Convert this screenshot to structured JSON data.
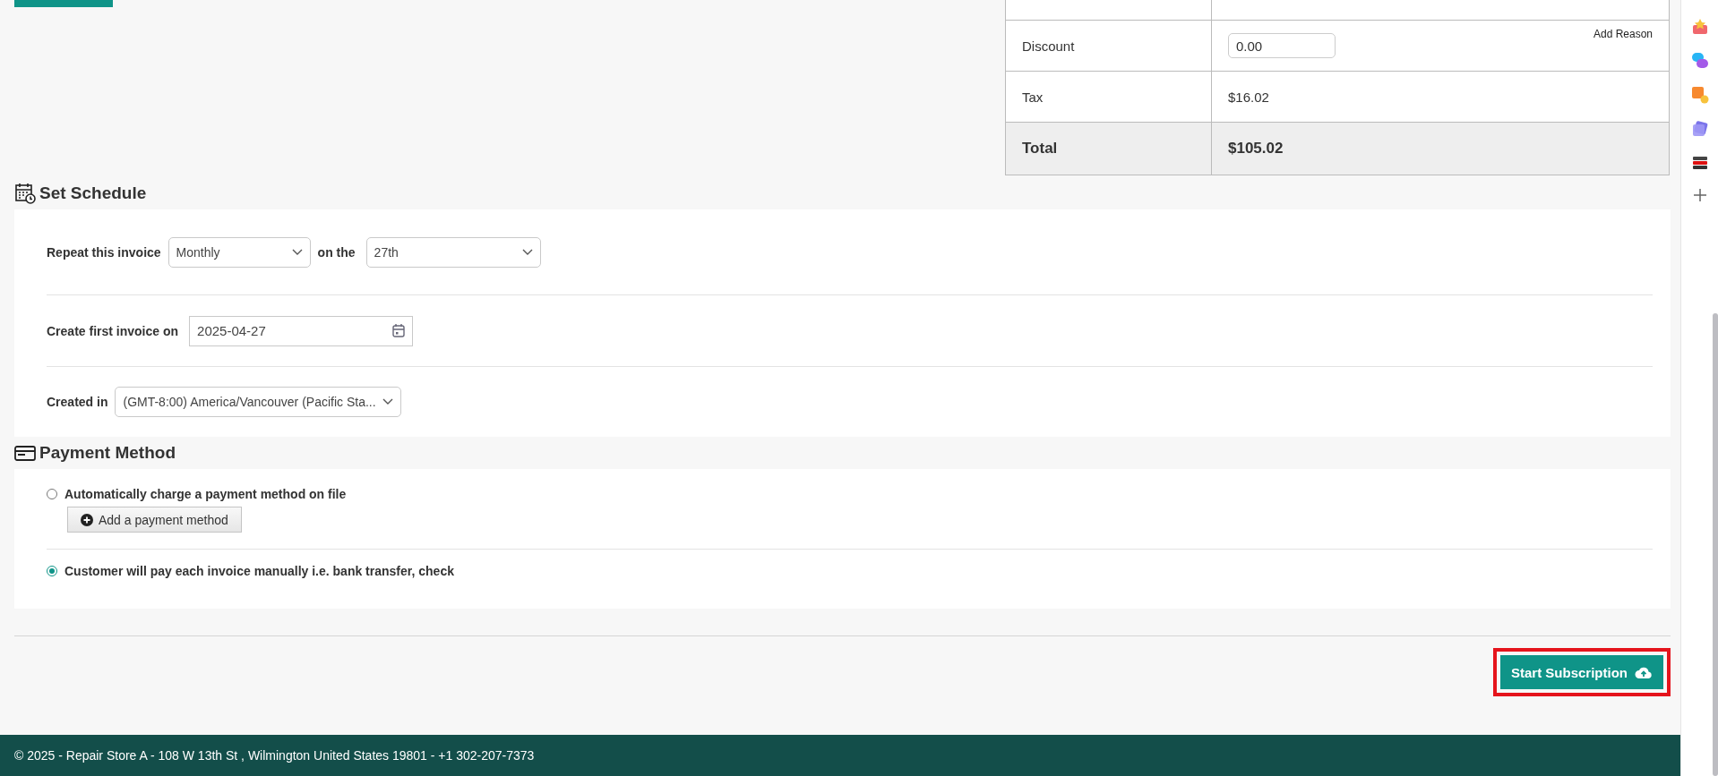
{
  "summary_table": {
    "rows": [
      {
        "kind": "blank",
        "label": "",
        "value": ""
      },
      {
        "kind": "input",
        "label": "Discount",
        "value": "0.00",
        "link": "Add Reason"
      },
      {
        "kind": "text",
        "label": "Tax",
        "value": "$16.02"
      },
      {
        "kind": "total",
        "label": "Total",
        "value": "$105.02"
      }
    ]
  },
  "schedule": {
    "title": "Set Schedule",
    "repeat": {
      "label": "Repeat this invoice",
      "frequency": "Monthly",
      "connector": "on the",
      "day": "27th"
    },
    "first_invoice": {
      "label": "Create first invoice on",
      "value": "2025-04-27"
    },
    "timezone": {
      "label": "Created in",
      "value": "(GMT-8:00) America/Vancouver (Pacific Sta..."
    }
  },
  "payment_method": {
    "title": "Payment Method",
    "options": [
      {
        "label": "Automatically charge a payment method on file",
        "selected": false,
        "button": "Add a payment method"
      },
      {
        "label": "Customer will pay each invoice manually i.e. bank transfer, check",
        "selected": true
      }
    ]
  },
  "start_button": {
    "label": "Start Subscription",
    "highlighted": true
  },
  "footer": "© 2025 - Repair Store A - 108 W 13th St , Wilmington United States 19801 - +1 302-207-7373"
}
